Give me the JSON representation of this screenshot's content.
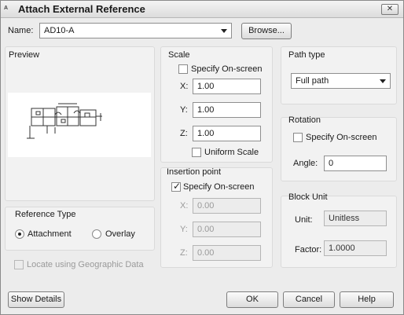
{
  "window": {
    "title": "Attach External Reference",
    "app_icon_text": "A",
    "close_icon": "close-x-icon"
  },
  "name": {
    "label": "Name:",
    "value": "AD10-A",
    "browse_label": "Browse..."
  },
  "preview": {
    "title": "Preview"
  },
  "reference_type": {
    "title": "Reference Type",
    "attachment_label": "Attachment",
    "overlay_label": "Overlay",
    "selected": "Attachment"
  },
  "geo": {
    "label": "Locate using Geographic Data",
    "checked": false,
    "enabled": false
  },
  "scale": {
    "title": "Scale",
    "specify_label": "Specify On-screen",
    "x_label": "X:",
    "x_value": "1.00",
    "y_label": "Y:",
    "y_value": "1.00",
    "z_label": "Z:",
    "z_value": "1.00",
    "uniform_label": "Uniform Scale"
  },
  "insertion": {
    "title": "Insertion point",
    "specify_label": "Specify On-screen",
    "specify_checked": true,
    "x_label": "X:",
    "x_value": "0.00",
    "y_label": "Y:",
    "y_value": "0.00",
    "z_label": "Z:",
    "z_value": "0.00"
  },
  "path_type": {
    "title": "Path type",
    "value": "Full path"
  },
  "rotation": {
    "title": "Rotation",
    "specify_label": "Specify On-screen",
    "angle_label": "Angle:",
    "angle_value": "0"
  },
  "block_unit": {
    "title": "Block Unit",
    "unit_label": "Unit:",
    "unit_value": "Unitless",
    "factor_label": "Factor:",
    "factor_value": "1.0000"
  },
  "buttons": {
    "show_details": "Show Details",
    "ok": "OK",
    "cancel": "Cancel",
    "help": "Help"
  }
}
